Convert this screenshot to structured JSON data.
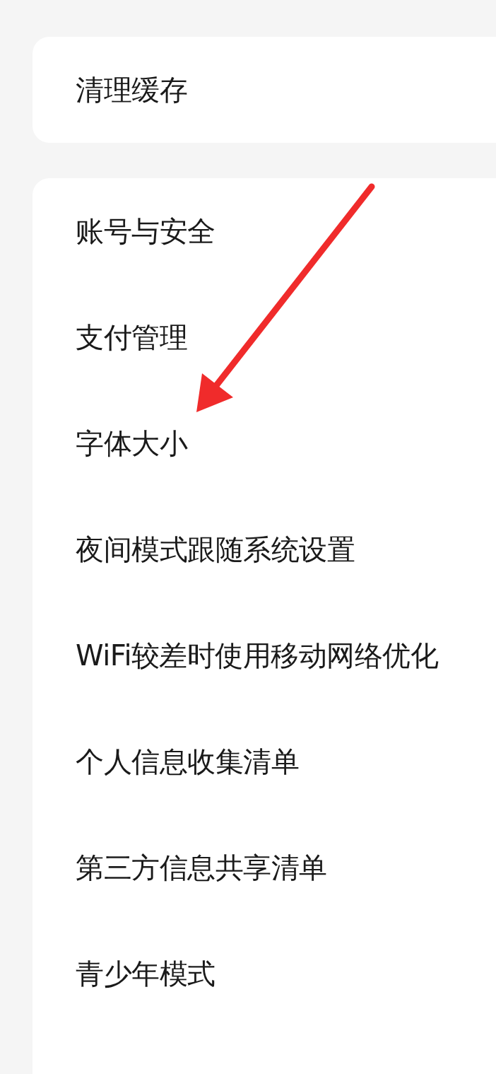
{
  "cards": [
    {
      "items": [
        {
          "label": "清理缓存"
        }
      ]
    },
    {
      "items": [
        {
          "label": "账号与安全"
        },
        {
          "label": "支付管理"
        },
        {
          "label": "字体大小"
        },
        {
          "label": "夜间模式跟随系统设置"
        },
        {
          "label": "WiFi较差时使用移动网络优化"
        },
        {
          "label": "个人信息收集清单"
        },
        {
          "label": "第三方信息共享清单"
        },
        {
          "label": "青少年模式"
        }
      ]
    }
  ],
  "annotations": [
    {
      "kind": "arrow"
    }
  ]
}
